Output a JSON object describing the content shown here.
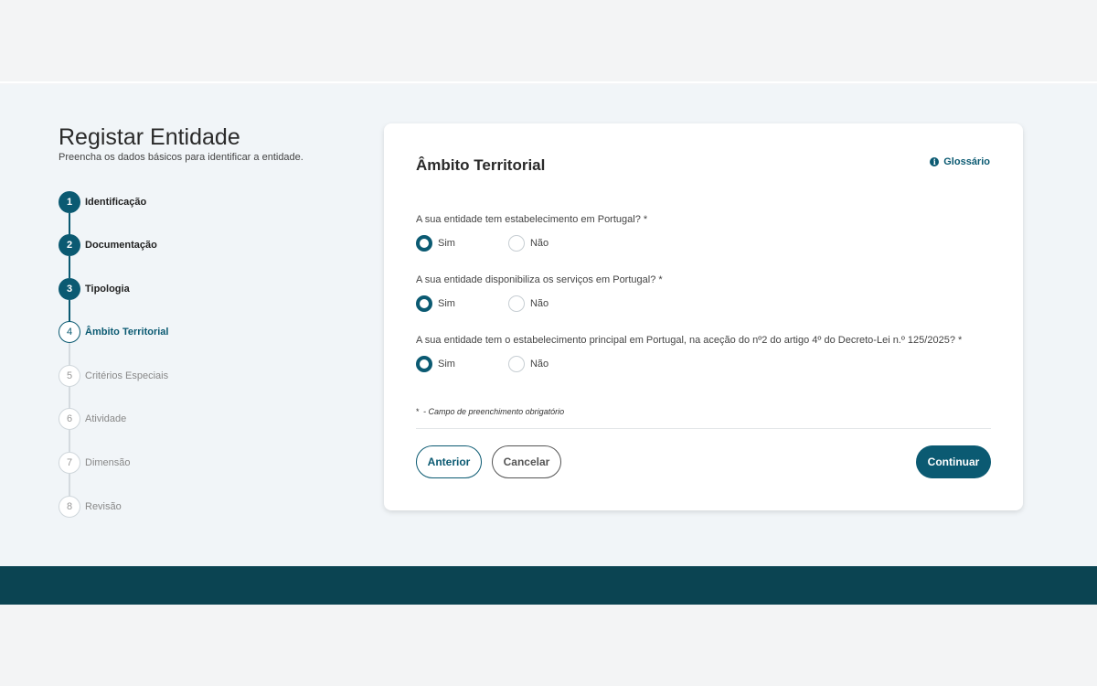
{
  "header": {
    "title": "Registar Entidade",
    "subtitle": "Preencha os dados básicos para identificar a entidade."
  },
  "steps": [
    {
      "number": "1",
      "label": "Identificação",
      "state": "done"
    },
    {
      "number": "2",
      "label": "Documentação",
      "state": "done"
    },
    {
      "number": "3",
      "label": "Tipologia",
      "state": "done"
    },
    {
      "number": "4",
      "label": "Âmbito Territorial",
      "state": "current"
    },
    {
      "number": "5",
      "label": "Critérios Especiais",
      "state": "todo"
    },
    {
      "number": "6",
      "label": "Atividade",
      "state": "todo"
    },
    {
      "number": "7",
      "label": "Dimensão",
      "state": "todo"
    },
    {
      "number": "8",
      "label": "Revisão",
      "state": "todo"
    }
  ],
  "card": {
    "title": "Âmbito Territorial",
    "glossary_label": "Glossário",
    "glossary_icon": "info-icon",
    "questions": [
      {
        "text": "A sua entidade tem estabelecimento em Portugal? *",
        "yes": "Sim",
        "no": "Não",
        "selected": "Sim"
      },
      {
        "text": "A sua entidade disponibiliza os serviços em Portugal? *",
        "yes": "Sim",
        "no": "Não",
        "selected": "Sim"
      },
      {
        "text": "A sua entidade tem o estabelecimento principal em Portugal, na aceção do nº2 do artigo 4º do Decreto-Lei n.º 125/2025? *",
        "yes": "Sim",
        "no": "Não",
        "selected": "Sim"
      }
    ],
    "required_star": "*",
    "required_note": "- Campo de preenchimento obrigatório"
  },
  "buttons": {
    "previous": "Anterior",
    "cancel": "Cancelar",
    "next": "Continuar"
  },
  "colors": {
    "primary": "#0b5a72",
    "footer": "#0b4452"
  }
}
